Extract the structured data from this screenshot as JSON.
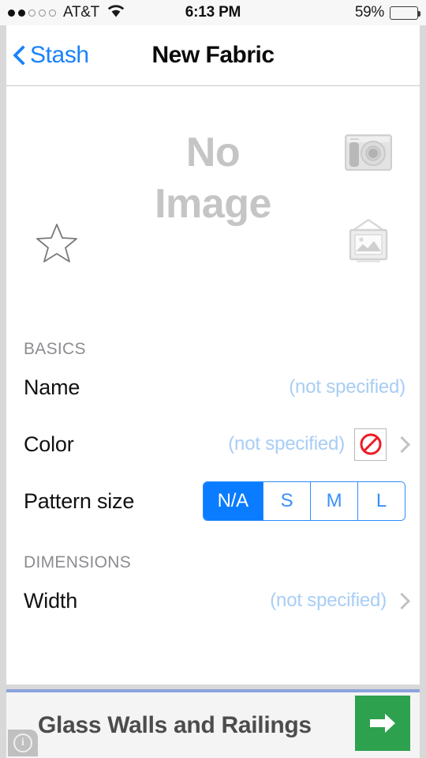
{
  "status_bar": {
    "signal_dots_filled": 2,
    "signal_dots_total": 5,
    "carrier": "AT&T",
    "wifi_icon": "wifi-icon",
    "time": "6:13 PM",
    "battery_percent": "59%",
    "battery_level": 59
  },
  "nav": {
    "back_label": "Stash",
    "back_icon": "chevron-left-icon",
    "title": "New Fabric"
  },
  "hero": {
    "placeholder_line1": "No",
    "placeholder_line2": "Image",
    "favorite_icon": "star-outline-icon",
    "camera_icon": "camera-icon",
    "photo_library_icon": "picture-frame-icon"
  },
  "sections": [
    {
      "header": "BASICS",
      "rows": [
        {
          "label": "Name",
          "value": "(not specified)",
          "has_chevron": false,
          "type": "text"
        },
        {
          "label": "Color",
          "value": "(not specified)",
          "has_chevron": true,
          "type": "color",
          "swatch_icon": "no-color-icon",
          "swatch_color": "#ee1b24"
        },
        {
          "label": "Pattern size",
          "type": "segmented",
          "options": [
            "N/A",
            "S",
            "M",
            "L"
          ],
          "selected": "N/A",
          "selected_index": 0
        }
      ]
    },
    {
      "header": "DIMENSIONS",
      "rows": [
        {
          "label": "Width",
          "value": "(not specified)",
          "has_chevron": true,
          "type": "text"
        }
      ]
    }
  ],
  "ad": {
    "headline": "Glass Walls and Railings",
    "cta_icon": "arrow-right-icon",
    "info_icon": "info-icon",
    "cta_color": "#2da14e",
    "divider_color": "#8ba4dd"
  },
  "theme": {
    "tint": "#1a82fb",
    "segmented_selected_bg": "#0a7cff",
    "placeholder_text": "#a8cdf5",
    "section_header": "#8c8c91"
  }
}
